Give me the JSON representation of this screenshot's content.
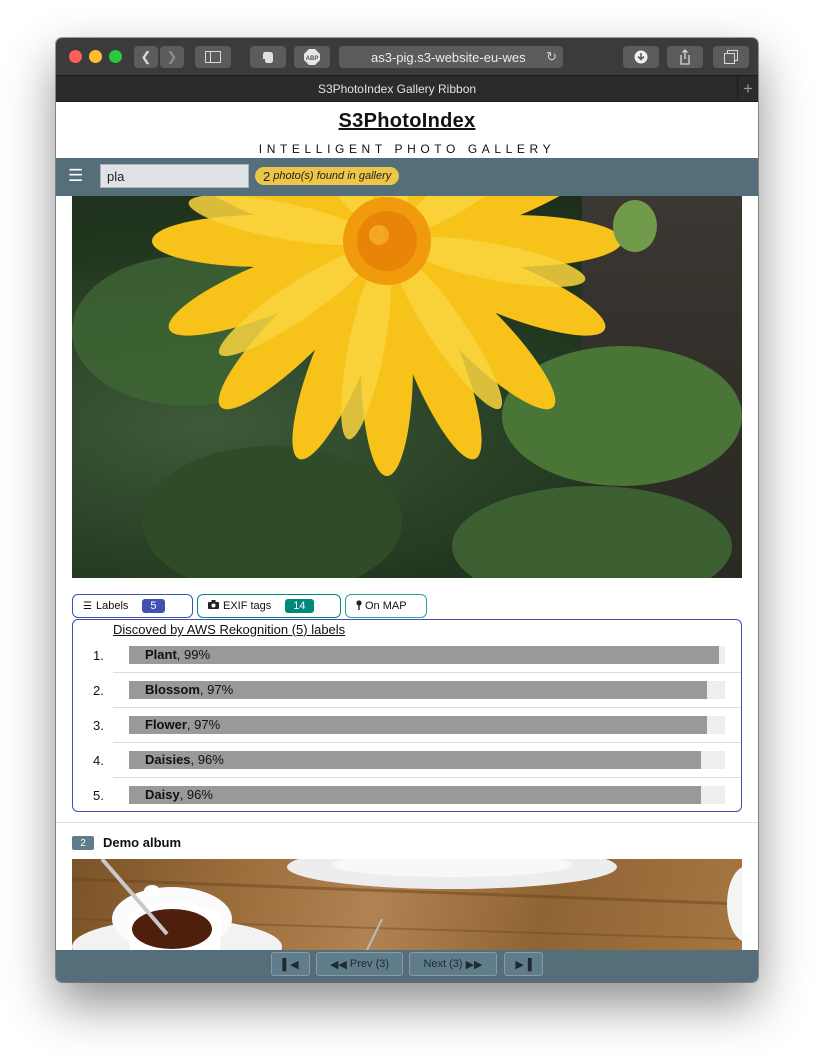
{
  "browser": {
    "address": "as3-pig.s3-website-eu-wes",
    "tab_title": "S3PhotoIndex Gallery Ribbon",
    "new_tab": "+"
  },
  "header": {
    "brand": "S3PhotoIndex",
    "subtitle": "INTELLIGENT PHOTO GALLERY"
  },
  "search": {
    "value": "pla",
    "results_count": "2",
    "results_text": "photo(s) found in gallery"
  },
  "tabs": [
    {
      "label": "Labels",
      "count": "5",
      "color": "#3f51b5"
    },
    {
      "label": "EXIF tags",
      "count": "14",
      "color": "#00897b"
    },
    {
      "label": "On MAP"
    }
  ],
  "labels_panel": {
    "title": "Discoved by AWS Rekognition (5) labels",
    "items": [
      {
        "num": "1.",
        "name": "Plant",
        "pct": ", 99%",
        "value": 99
      },
      {
        "num": "2.",
        "name": "Blossom",
        "pct": ", 97%",
        "value": 97
      },
      {
        "num": "3.",
        "name": "Flower",
        "pct": ", 97%",
        "value": 97
      },
      {
        "num": "4.",
        "name": "Daisies",
        "pct": ", 96%",
        "value": 96
      },
      {
        "num": "5.",
        "name": "Daisy",
        "pct": ", 96%",
        "value": 96
      }
    ]
  },
  "album": {
    "count": "2",
    "name": "Demo album"
  },
  "pagination": {
    "prev_label": "Prev (3)",
    "next_label": "Next (3)"
  },
  "colors": {
    "navbar": "#546e7a",
    "results_badge": "#ecc648",
    "labels_accent": "#3f51b5",
    "exif_accent": "#00897b",
    "map_accent": "#26a69a"
  }
}
